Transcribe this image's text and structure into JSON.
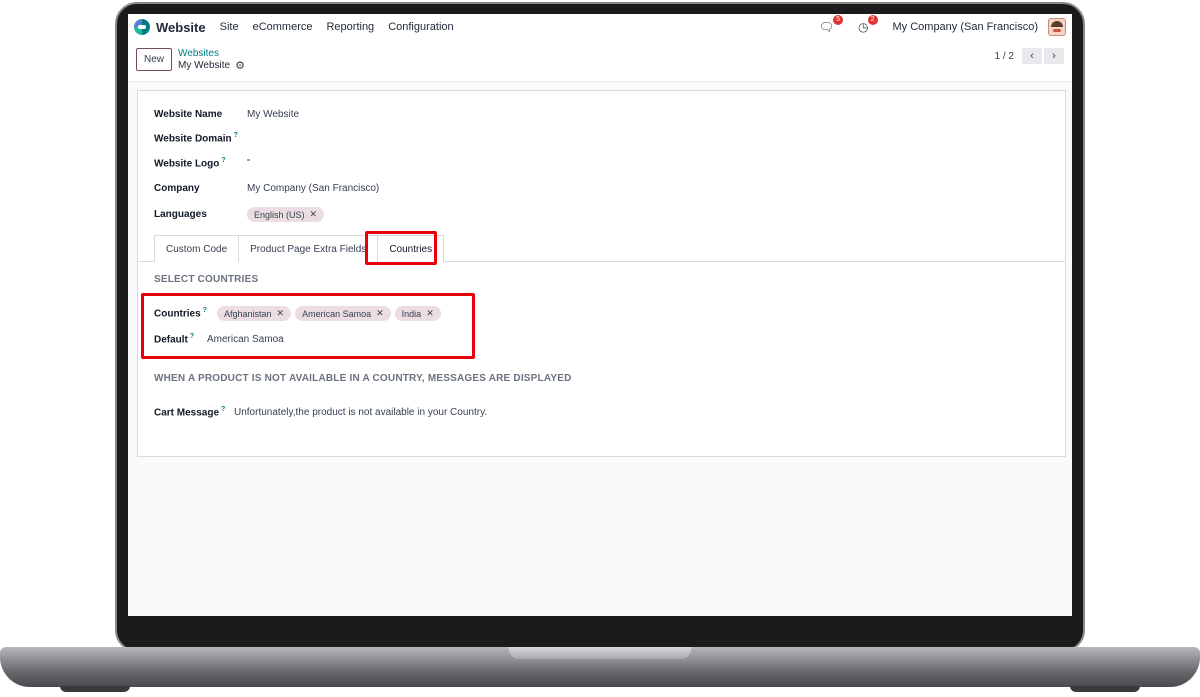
{
  "navbar": {
    "app_name": "Website",
    "menu": [
      "Site",
      "eCommerce",
      "Reporting",
      "Configuration"
    ],
    "messages_count": "5",
    "activities_count": "2",
    "company": "My Company (San Francisco)"
  },
  "control_panel": {
    "new_label": "New",
    "breadcrumb_parent": "Websites",
    "breadcrumb_current": "My Website",
    "pager_value": "1 / 2"
  },
  "form": {
    "website_name_label": "Website Name",
    "website_name_value": "My Website",
    "website_domain_label": "Website Domain",
    "website_logo_label": "Website Logo",
    "company_label": "Company",
    "company_value": "My Company (San Francisco)",
    "languages_label": "Languages",
    "languages": [
      "English (US)"
    ],
    "help_mark": "?"
  },
  "tabs": [
    "Custom Code",
    "Product Page Extra Fields",
    "Countries"
  ],
  "active_tab": "Countries",
  "countries_tab": {
    "section_title": "SELECT COUNTRIES",
    "countries_label": "Countries",
    "countries": [
      "Afghanistan",
      "American Samoa",
      "India"
    ],
    "default_label": "Default",
    "default_value": "American Samoa",
    "message_section_title": "WHEN A PRODUCT IS NOT AVAILABLE IN A COUNTRY, MESSAGES ARE DISPLAYED",
    "cart_message_label": "Cart Message",
    "cart_message_value": "Unfortunately,the product is not available in your Country."
  },
  "colors": {
    "highlight": "#e8000b",
    "brand_link": "#017e84",
    "tag_bg": "#ebdde2",
    "new_button_border": "#714b67"
  }
}
